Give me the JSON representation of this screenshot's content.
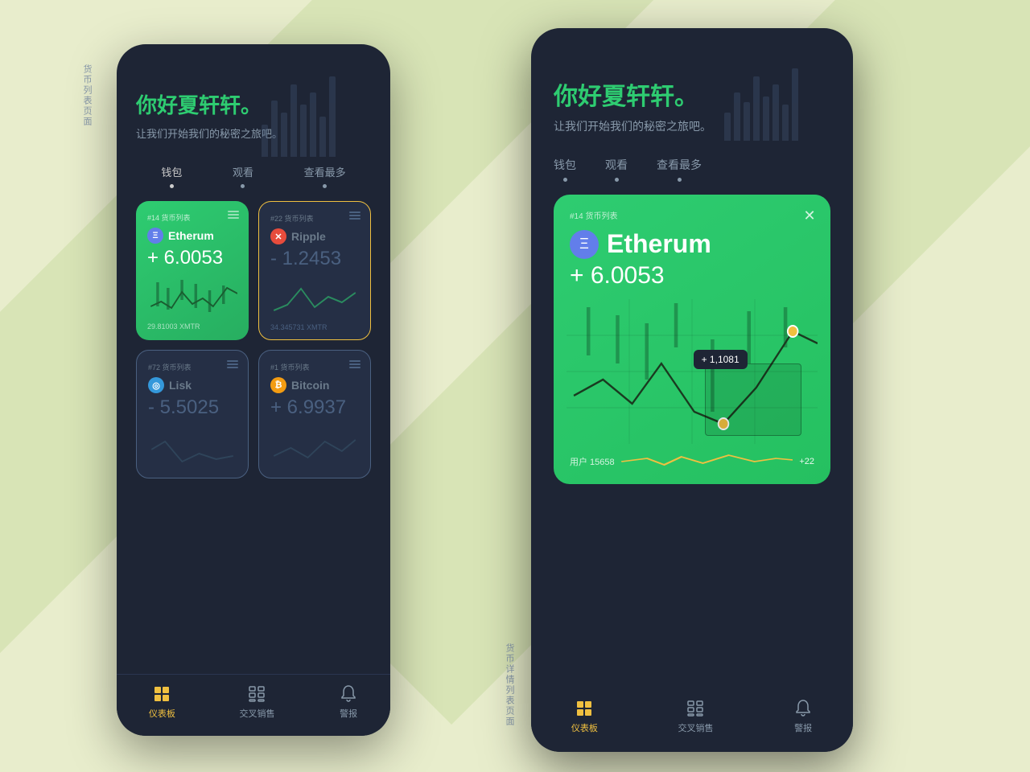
{
  "background": {
    "color": "#e8edcc"
  },
  "side_label_left": "货币列表页面",
  "side_label_right": "货币详情列表页面",
  "left_phone": {
    "greeting_title": "你好夏轩轩。",
    "greeting_sub": "让我们开始我们的秘密之旅吧。",
    "nav_tabs": [
      {
        "label": "钱包",
        "active": true
      },
      {
        "label": "观看",
        "active": false
      },
      {
        "label": "查看最多",
        "active": false
      }
    ],
    "cards": [
      {
        "rank": "#14 货币列表",
        "coin": "Etherum",
        "icon": "Ξ",
        "icon_class": "eth-icon",
        "value": "+ 6.0053",
        "xmtr": "29.81003 XMTR",
        "style": "green"
      },
      {
        "rank": "#22 货币列表",
        "coin": "Ripple",
        "icon": "✕",
        "icon_class": "xrp-icon",
        "value": "- 1.2453",
        "xmtr": "34.345731 XMTR",
        "style": "dark"
      },
      {
        "rank": "#72 货币列表",
        "coin": "Lisk",
        "icon": "◎",
        "icon_class": "lisk-icon",
        "value": "- 5.5025",
        "xmtr": "",
        "style": "dark2"
      },
      {
        "rank": "#1 货币列表",
        "coin": "Bitcoin",
        "icon": "₿",
        "icon_class": "btc-icon",
        "value": "+ 6.9937",
        "xmtr": "",
        "style": "dark2"
      }
    ],
    "bottom_nav": [
      {
        "label": "仪表板",
        "active": true,
        "icon": "dashboard"
      },
      {
        "label": "交叉销售",
        "active": false,
        "icon": "cross-sell"
      },
      {
        "label": "警报",
        "active": false,
        "icon": "bell"
      }
    ]
  },
  "right_phone": {
    "greeting_title": "你好夏轩轩。",
    "greeting_sub": "让我们开始我们的秘密之旅吧。",
    "nav_tabs": [
      {
        "label": "钱包"
      },
      {
        "label": "观看"
      },
      {
        "label": "查看最多"
      }
    ],
    "modal": {
      "rank": "#14 货币列表",
      "coin": "Etherum",
      "icon": "Ξ",
      "value": "+ 6.0053",
      "chart_tooltip": "+ 1,1081",
      "footer_users": "用户 15658",
      "footer_change": "+22"
    },
    "bottom_nav": [
      {
        "label": "仪表板",
        "active": true,
        "icon": "dashboard"
      },
      {
        "label": "交叉销售",
        "active": false,
        "icon": "cross-sell"
      },
      {
        "label": "警报",
        "active": false,
        "icon": "bell"
      }
    ]
  }
}
